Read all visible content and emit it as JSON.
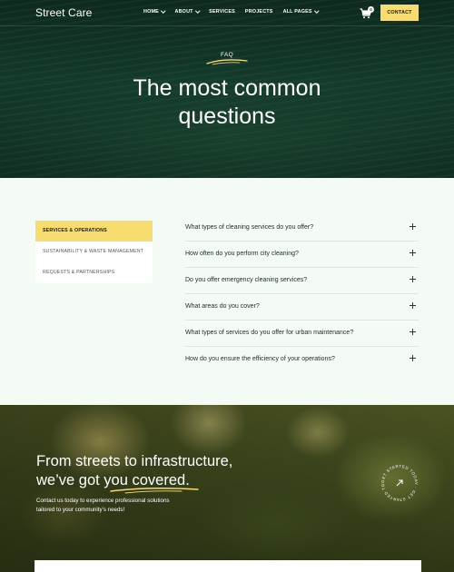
{
  "nav": {
    "brand": "Street Care",
    "menu": [
      {
        "label": "HOME",
        "dropdown": true
      },
      {
        "label": "ABOUT",
        "dropdown": true
      },
      {
        "label": "SERVICES",
        "dropdown": false
      },
      {
        "label": "PROJECTS",
        "dropdown": false
      },
      {
        "label": "ALL PAGES",
        "dropdown": true
      }
    ],
    "cart_count": "0",
    "contact_label": "CONTACT"
  },
  "hero": {
    "tag": "FAQ",
    "title_line1": "The most common",
    "title_line2": "questions"
  },
  "faq": {
    "categories": [
      {
        "label": "SERVICES & OPERATIONS",
        "active": true
      },
      {
        "label": "SUSTAINABILITY & WASTE MANAGEMENT",
        "active": false
      },
      {
        "label": "REQUESTS & PARTNERSHIPS",
        "active": false
      }
    ],
    "questions": [
      "What types of cleaning services do you offer?",
      "How often do you perform city cleaning?",
      "Do you offer emergency cleaning services?",
      "What areas do you cover?",
      "What types of services do you offer for urban maintenance?",
      "How do you ensure the efficiency of your operations?"
    ]
  },
  "cta": {
    "title_line1": "From streets to infrastructure,",
    "title_line2_prefix": "we’ve got ",
    "title_highlight": "you covered",
    "title_suffix": ".",
    "subtitle_line1": "Contact us today to experience professional solutions",
    "subtitle_line2": "tailored to your community’s needs!",
    "badge_text": "GET STARTED TODAY · GET STARTED TODAY ·"
  },
  "colors": {
    "hero_bg": "#0d2a1d",
    "accent_yellow": "#f7dc6f",
    "faq_bg": "#f3fbf4"
  }
}
